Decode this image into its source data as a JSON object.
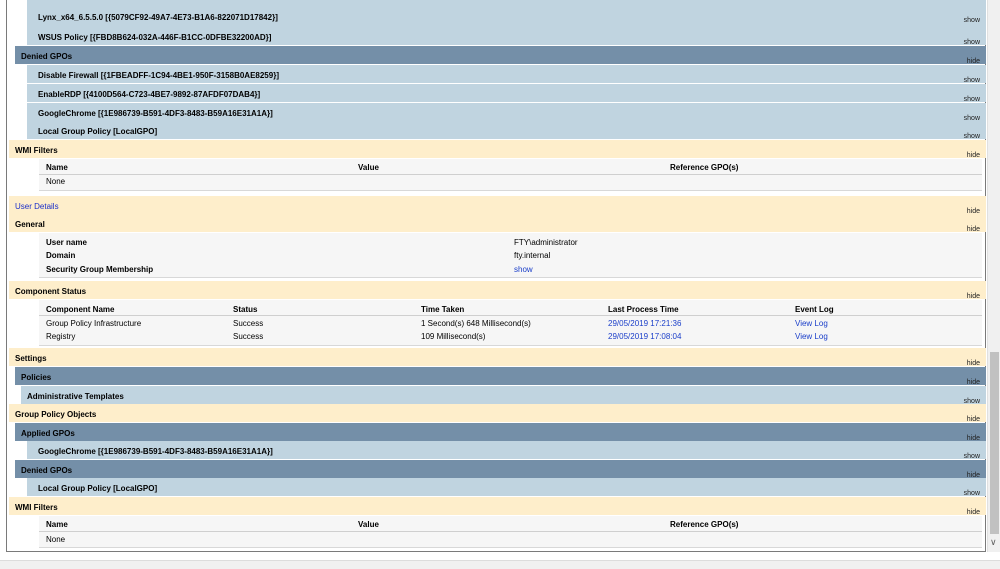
{
  "toggles": {
    "show": "show",
    "hide": "hide"
  },
  "top_gpos": [
    "Lynx_x64_6.5.5.0 [{5079CF92-49A7-4E73-B1A6-822071D17842}]",
    "WSUS Policy [{FBD8B624-032A-446F-B1CC-0DFBE32200AD}]"
  ],
  "denied_heading": "Denied GPOs",
  "denied_gpos": [
    "Disable Firewall [{1FBEADFF-1C94-4BE1-950F-3158B0AE8259}]",
    "EnableRDP [{4100D564-C723-4BE7-9892-87AFDF07DAB4}]",
    "GoogleChrome [{1E986739-B591-4DF3-8483-B59A16E31A1A}]",
    "Local Group Policy [LocalGPO]"
  ],
  "wmi_heading": "WMI Filters",
  "wmi_columns": [
    "Name",
    "Value",
    "Reference GPO(s)"
  ],
  "wmi_none": "None",
  "user_details": "User Details",
  "general_heading": "General",
  "general": [
    {
      "key": "User name",
      "value": "FTY\\administrator"
    },
    {
      "key": "Domain",
      "value": "fty.internal"
    },
    {
      "key": "Security Group Membership",
      "value": "show"
    }
  ],
  "component_heading": "Component Status",
  "component_columns": [
    "Component Name",
    "Status",
    "Time Taken",
    "Last Process Time",
    "Event Log"
  ],
  "components": [
    {
      "name": "Group Policy Infrastructure",
      "status": "Success",
      "time": "1 Second(s) 648 Millisecond(s)",
      "last": "29/05/2019 17:21:36",
      "log": "View Log"
    },
    {
      "name": "Registry",
      "status": "Success",
      "time": "109 Millisecond(s)",
      "last": "29/05/2019 17:08:04",
      "log": "View Log"
    }
  ],
  "settings_heading": "Settings",
  "policies_heading": "Policies",
  "admin_templates": "Administrative Templates",
  "gpo_objects_heading": "Group Policy Objects",
  "applied_heading": "Applied GPOs",
  "applied_gpos": [
    "GoogleChrome [{1E986739-B591-4DF3-8483-B59A16E31A1A}]"
  ],
  "denied_gpos_2": [
    "Local Group Policy [LocalGPO]"
  ],
  "scroll_arrow": "∨"
}
